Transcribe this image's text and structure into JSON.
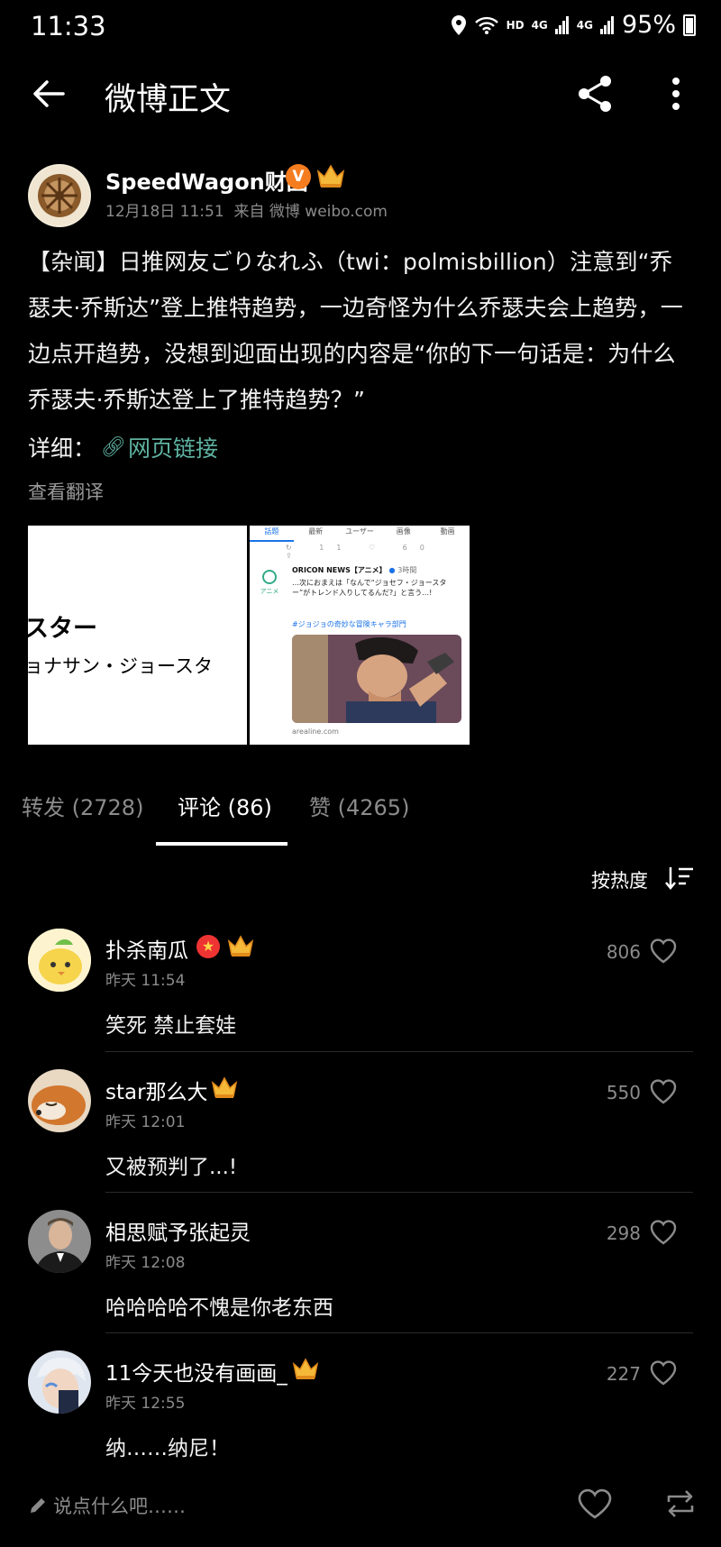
{
  "status_bar": {
    "time": "11:33",
    "network": "HD",
    "signal_1": "4G",
    "signal_2": "4G",
    "battery": "95%"
  },
  "header": {
    "title": "微博正文"
  },
  "post": {
    "author": "SpeedWagon财团",
    "verified_badge": "V",
    "date": "12月18日 11:51",
    "source": "来自 微博 weibo.com",
    "body": "【杂闻】日推网友ごりなれふ（twi：polmisbillion）注意到“乔瑟夫·乔斯达”登上推特趋势，一边奇怪为什么乔瑟夫会上趋势，一边点开趋势，没想到迎面出现的内容是“你的下一句话是：为什么乔瑟夫·乔斯达登上了推特趋势？”",
    "detail_label": "详细：",
    "link_text": "网页链接",
    "translate": "查看翻译",
    "image1": {
      "line1": "スター",
      "line2": "ョナサン・ジョースタ"
    },
    "image2": {
      "tabs": [
        "話題",
        "最新",
        "ユーザー",
        "画像",
        "動画"
      ],
      "icons": "↻ 11  ♡ 60  ⇪",
      "account": "ORICON NEWS【アニメ】",
      "ago": "3時間",
      "text": "…次におまえは「なんで“ジョセフ・ジョースター”がトレンド入りしてるんだ?」と言う…!",
      "hashtag": "#ジョジョの奇妙な冒険キャラ部門",
      "logo_text": "アニメ",
      "url": "arealine.com"
    }
  },
  "tabs": [
    {
      "label": "转发 (2728)"
    },
    {
      "label": "评论 (86)"
    },
    {
      "label": "赞 (4265)"
    }
  ],
  "sort": {
    "label": "按热度"
  },
  "comments": [
    {
      "name": "扑杀南瓜",
      "time": "昨天 11:54",
      "text": "笑死 禁止套娃",
      "likes": "806",
      "avatar": "yellow-chick"
    },
    {
      "name": "star那么大",
      "time": "昨天 12:01",
      "text": "又被预判了...!",
      "likes": "550",
      "avatar": "fox"
    },
    {
      "name": "相思赋予张起灵",
      "time": "昨天 12:08",
      "text": "哈哈哈哈不愧是你老东西",
      "likes": "298",
      "avatar": "man-in-suit"
    },
    {
      "name": "11今天也没有画画_",
      "time": "昨天 12:55",
      "text": "纳……纳尼！",
      "likes": "227",
      "avatar": "anime-boy"
    }
  ],
  "bottom_bar": {
    "compose_placeholder": "说点什么吧……"
  },
  "colors": {
    "background": "#000000",
    "link": "#5fb3a1",
    "muted": "#8b8b8b",
    "badge": "#f57c1f"
  }
}
